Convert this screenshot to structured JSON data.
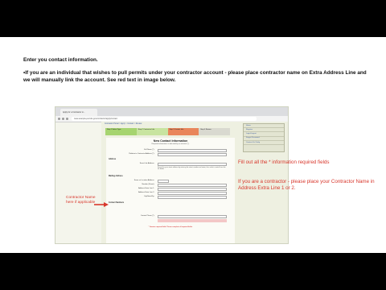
{
  "slide": {
    "heading": "Enter you contact information.",
    "bullet": "•If you are an individual that wishes to pull permits under your contractor account - please place contractor name on Extra Address Line and we will manually link the account. See red text in image below."
  },
  "browser": {
    "tab": "Apply for a Contractor Li...",
    "url": "www.example-permits.gov/contractor/apply/contact"
  },
  "page": {
    "breadcrumbs": "Contractor Portal > Apply > Contact > Review",
    "steps": [
      "Step 1 Select Type",
      "Step 2 Contractor Info",
      "Step 3 Contact Info",
      "Step 4 Review"
    ],
    "form_title": "New Contact Information",
    "form_subtitle": "Required information is indicated by an asterisk (*).",
    "fields_top": [
      "Full Name (*):",
      "Relation to Contractor Address (*):"
    ],
    "section_address": "Address",
    "label_search": "Search for Address:",
    "address_note": "Search for your street address by entering the street number and name, then select a match from the list below.",
    "section_mailing": "Mailing Address",
    "fields_mailing": [
      "Same as Location Address:",
      "Number (Street):",
      "Address Extra Line 1:",
      "Address Extra Line 2:",
      "City/State/Zip:"
    ],
    "section_numbers": "Contact Numbers",
    "field_phone": "Contact Phone (*):",
    "required_note": "* Denotes required field. Please complete all required fields.",
    "sidebar": [
      "Home",
      "Register",
      "Login/Logout",
      "Forgot Password",
      "Contact Us / Help"
    ]
  },
  "annotations": {
    "contractor_name_line1": "Contractor Name",
    "contractor_name_line2": "here if applicable",
    "helper1": "Fill out all the * information required fields",
    "helper2": "If you are a contractor - please place your Contractor Name in Address Extra Line 1 or 2."
  }
}
